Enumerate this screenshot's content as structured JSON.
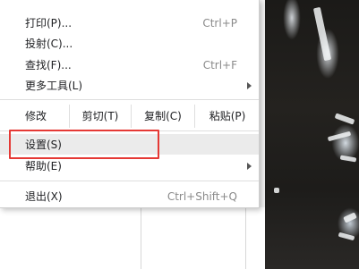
{
  "menu": {
    "print": {
      "label": "打印(P)...",
      "shortcut": "Ctrl+P"
    },
    "cast": {
      "label": "投射(C)..."
    },
    "find": {
      "label": "查找(F)...",
      "shortcut": "Ctrl+F"
    },
    "more_tools": {
      "label": "更多工具(L)"
    },
    "edit": {
      "label": "修改",
      "cut": "剪切(T)",
      "copy": "复制(C)",
      "paste": "粘贴(P)"
    },
    "settings": {
      "label": "设置(S)"
    },
    "help": {
      "label": "帮助(E)"
    },
    "exit": {
      "label": "退出(X)",
      "shortcut": "Ctrl+Shift+Q"
    }
  },
  "colors": {
    "highlight_border": "#e53935",
    "hover_background": "#ebebeb"
  }
}
